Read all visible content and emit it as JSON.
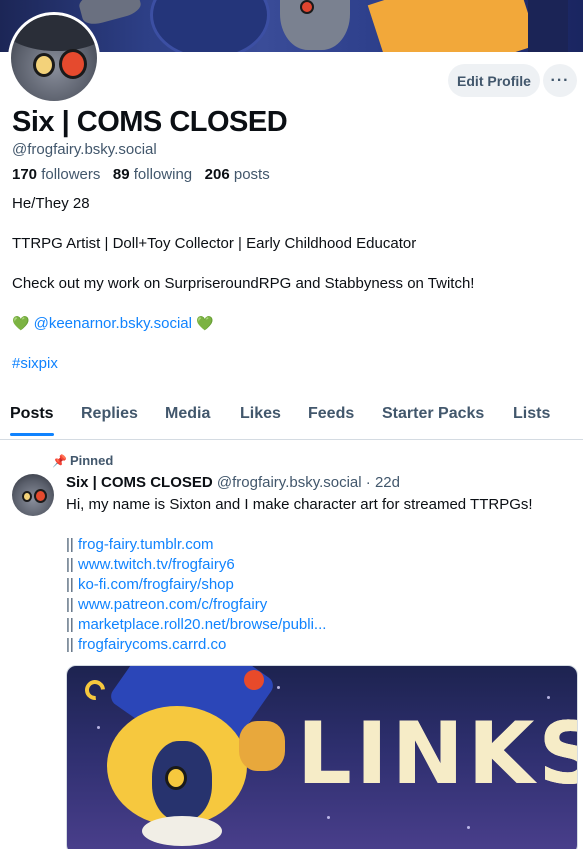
{
  "profile": {
    "display_name": "Six | COMS CLOSED",
    "handle": "@frogfairy.bsky.social",
    "followers_count": "170",
    "followers_label": "followers",
    "following_count": "89",
    "following_label": "following",
    "posts_count": "206",
    "posts_label": "posts",
    "edit_profile_label": "Edit Profile",
    "more_label": "···"
  },
  "bio": {
    "line1": "He/They 28",
    "line2": "TTRPG Artist | Doll+Toy Collector | Early Childhood Educator",
    "line3": "Check out my work on SurpriseroundRPG and Stabbyness on Twitch!",
    "heart": "💚",
    "mention": "@keenarnor.bsky.social",
    "hashtag": "#sixpix"
  },
  "tabs": [
    {
      "label": "Posts"
    },
    {
      "label": "Replies"
    },
    {
      "label": "Media"
    },
    {
      "label": "Likes"
    },
    {
      "label": "Feeds"
    },
    {
      "label": "Starter Packs"
    },
    {
      "label": "Lists"
    }
  ],
  "post": {
    "pinned_label": "Pinned",
    "pin_icon": "📌",
    "author_name": "Six | COMS CLOSED",
    "author_handle": "@frogfairy.bsky.social",
    "separator": "·",
    "time": "22d",
    "text": "Hi, my name is Sixton and I make character art for streamed TTRPGs!",
    "bar": "||",
    "links": [
      "frog-fairy.tumblr.com",
      "www.twitch.tv/frogfairy6",
      "ko-fi.com/frogfairy/shop",
      "www.patreon.com/c/frogfairy",
      "marketplace.roll20.net/browse/publi...",
      "frogfairycoms.carrd.co"
    ],
    "image_text": "LINKS"
  },
  "colors": {
    "accent": "#1083fe",
    "muted": "#42576c",
    "heart": "#1ec77a"
  }
}
